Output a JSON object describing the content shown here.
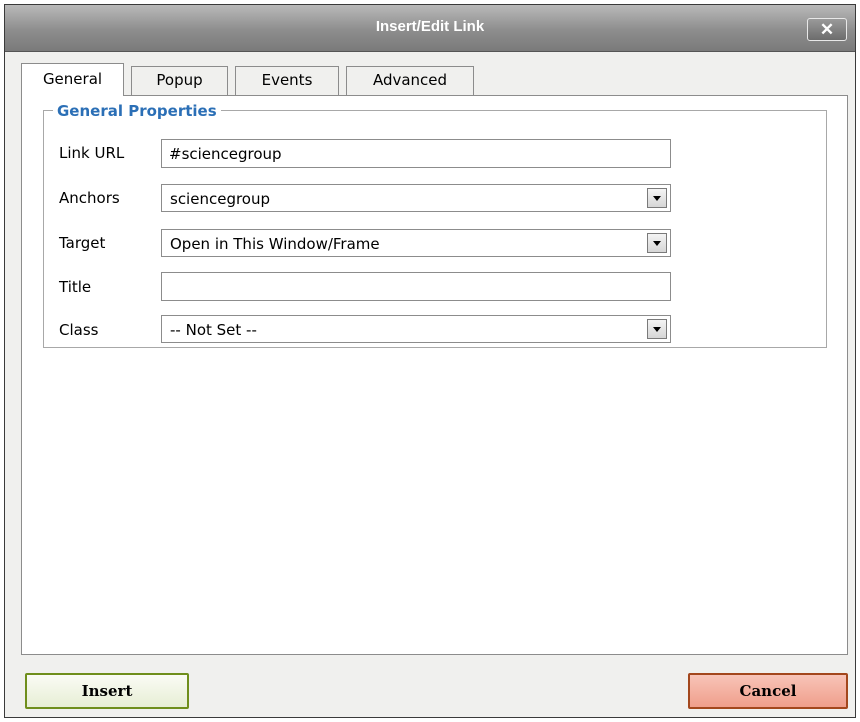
{
  "window": {
    "title": "Insert/Edit Link",
    "close_label": "✕"
  },
  "tabs": [
    {
      "label": "General",
      "active": true
    },
    {
      "label": "Popup",
      "active": false
    },
    {
      "label": "Events",
      "active": false
    },
    {
      "label": "Advanced",
      "active": false
    }
  ],
  "general": {
    "legend": "General Properties",
    "link_url": {
      "label": "Link URL",
      "value": "#sciencegroup"
    },
    "anchors": {
      "label": "Anchors",
      "value": "sciencegroup"
    },
    "target": {
      "label": "Target",
      "value": "Open in This Window/Frame"
    },
    "title": {
      "label": "Title",
      "value": ""
    },
    "class": {
      "label": "Class",
      "value": "-- Not Set --"
    }
  },
  "buttons": {
    "insert": "Insert",
    "cancel": "Cancel"
  },
  "colors": {
    "legend": "#2b6fb6",
    "insert_border": "#6f8e1c",
    "cancel_border": "#a3471d",
    "titlebar": "#8d8d8d"
  }
}
